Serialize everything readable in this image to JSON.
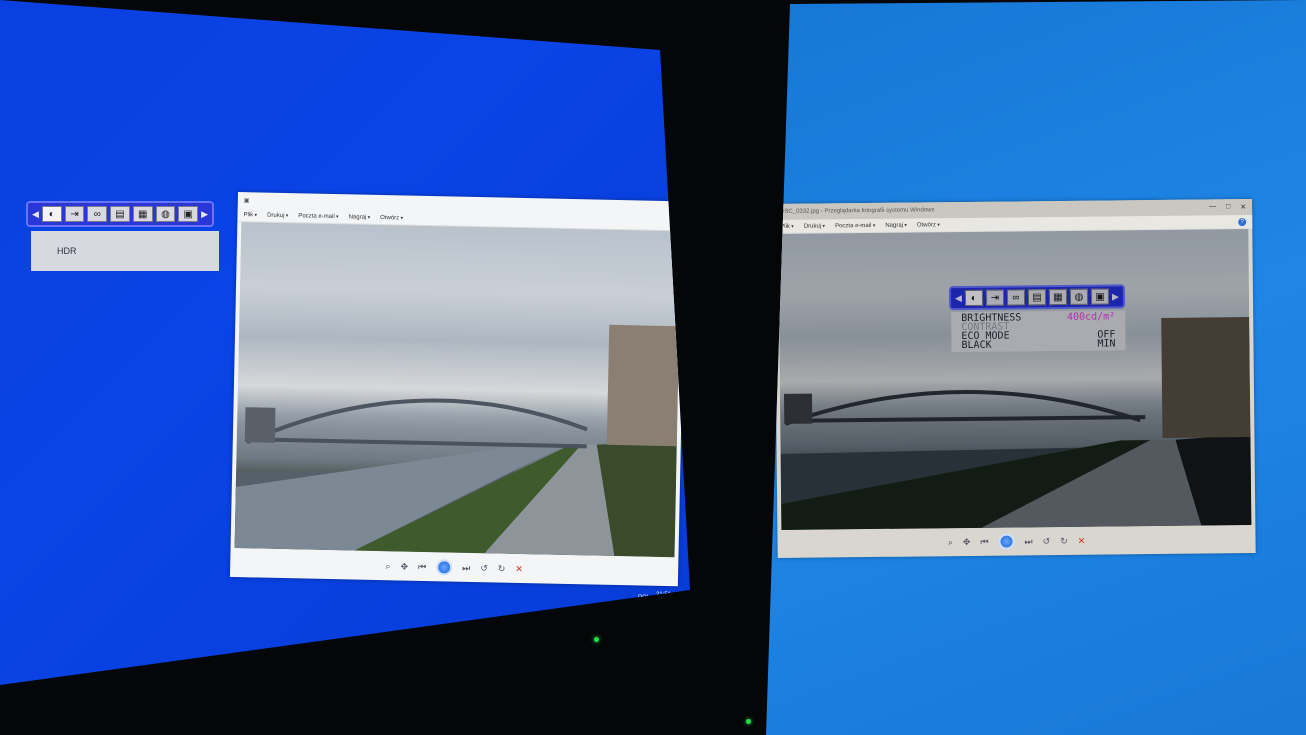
{
  "left_screen": {
    "osd": {
      "icons": [
        "picture-icon",
        "input-icon",
        "color-icon",
        "image-setup-icon",
        "display-icon",
        "pip-icon",
        "system-icon"
      ],
      "panel_item": "HDR"
    },
    "viewer": {
      "menu": [
        "Plik",
        "Drukuj",
        "Poczta e-mail",
        "Nagraj",
        "Otwórz"
      ],
      "help": "?"
    },
    "taskbar": {
      "lang": "POL",
      "time": "21:51"
    }
  },
  "right_screen": {
    "viewer": {
      "title": "DSC_0332.jpg - Przeglądarka fotografii systemu Windows",
      "menu": [
        "Plik",
        "Drukuj",
        "Poczta e-mail",
        "Nagraj",
        "Otwórz"
      ],
      "help": "?",
      "window_controls": [
        "—",
        "□",
        "✕"
      ]
    },
    "osd": {
      "icons": [
        "picture-icon",
        "input-icon",
        "color-icon",
        "image-setup-icon",
        "display-icon",
        "pip-icon",
        "system-icon"
      ],
      "rows": [
        {
          "label": "BRIGHTNESS",
          "value": "400cd/m²"
        },
        {
          "label": "CONTRAST",
          "value": ""
        },
        {
          "label": "ECO MODE",
          "value": "OFF"
        },
        {
          "label": "BLACK",
          "value": "MIN"
        }
      ]
    }
  },
  "colors": {
    "osd_highlight": "#e040e0",
    "left_background": "#0a41e2",
    "right_background": "#1a7ddc"
  }
}
